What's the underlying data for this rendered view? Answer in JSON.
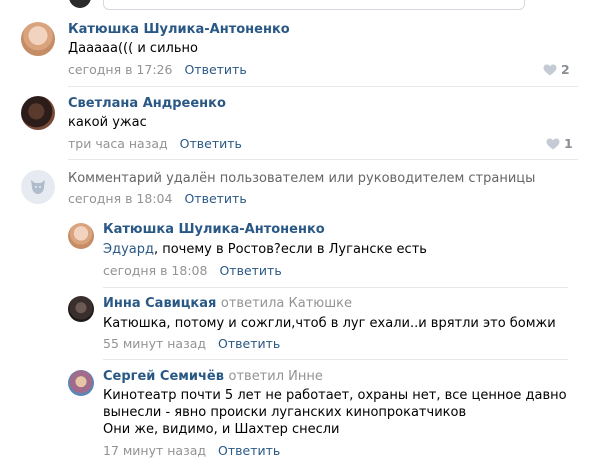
{
  "comments": [
    {
      "author": "Катюшка Шулика-Антоненко",
      "text": "Дааааа((( и сильно",
      "time": "сегодня в 17:26",
      "reply": "Ответить",
      "likes": "2"
    },
    {
      "author": "Светлана Андреенко",
      "text": "какой ужас",
      "time": "три часа назад",
      "reply": "Ответить",
      "likes": "1"
    },
    {
      "deleted_text": "Комментарий удалён пользователем или руководителем страницы",
      "time": "сегодня в 18:04",
      "reply": "Ответить"
    }
  ],
  "replies": [
    {
      "author": "Катюшка Шулика-Антоненко",
      "mention": "Эдуард",
      "text": ", почему в Ростов?если в Луганске есть",
      "time": "сегодня в 18:08",
      "reply": "Ответить"
    },
    {
      "author": "Инна Савицкая",
      "reply_to": "ответила Катюшке",
      "text": "Катюшка, потому и сожгли,чтоб в луг ехали..и врятли это бомжи",
      "time": "55 минут назад",
      "reply": "Ответить"
    },
    {
      "author": "Сергей Семичёв",
      "reply_to": "ответил Инне",
      "text_lines": [
        "Кинотеатр почти 5 лет не работает, охраны нет, все ценное давно",
        "вынесли - явно происки луганских кинопрокатчиков",
        "Они же, видимо, и Шахтер снесли"
      ],
      "time": "17 минут назад",
      "reply": "Ответить"
    }
  ]
}
